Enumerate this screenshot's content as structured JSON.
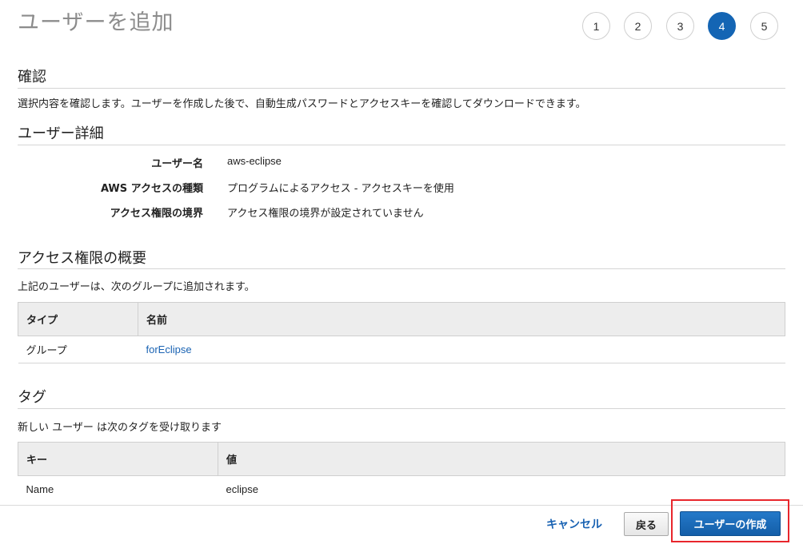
{
  "page": {
    "title": "ユーザーを追加"
  },
  "steps": [
    "1",
    "2",
    "3",
    "4",
    "5"
  ],
  "active_step": "4",
  "review": {
    "title": "確認",
    "description": "選択内容を確認します。ユーザーを作成した後で、自動生成パスワードとアクセスキーを確認してダウンロードできます。"
  },
  "user_details": {
    "title": "ユーザー詳細",
    "rows": [
      {
        "label": "ユーザー名",
        "value": "aws-eclipse"
      },
      {
        "label": "AWS アクセスの種類",
        "value": "プログラムによるアクセス - アクセスキーを使用"
      },
      {
        "label": "アクセス権限の境界",
        "value": "アクセス権限の境界が設定されていません"
      }
    ]
  },
  "permissions": {
    "title": "アクセス権限の概要",
    "description": "上記のユーザーは、次のグループに追加されます。",
    "headers": [
      "タイプ",
      "名前"
    ],
    "rows": [
      {
        "type": "グループ",
        "name": "forEclipse"
      }
    ]
  },
  "tags": {
    "title": "タグ",
    "description": "新しい ユーザー は次のタグを受け取ります",
    "headers": [
      "キー",
      "値"
    ],
    "rows": [
      {
        "key": "Name",
        "value": "eclipse"
      }
    ]
  },
  "footer": {
    "cancel_label": "キャンセル",
    "back_label": "戻る",
    "create_label": "ユーザーの作成",
    "highlight_color": "#e8262c"
  },
  "colors": {
    "accent": "#1465b4",
    "link": "#1a63b3"
  }
}
